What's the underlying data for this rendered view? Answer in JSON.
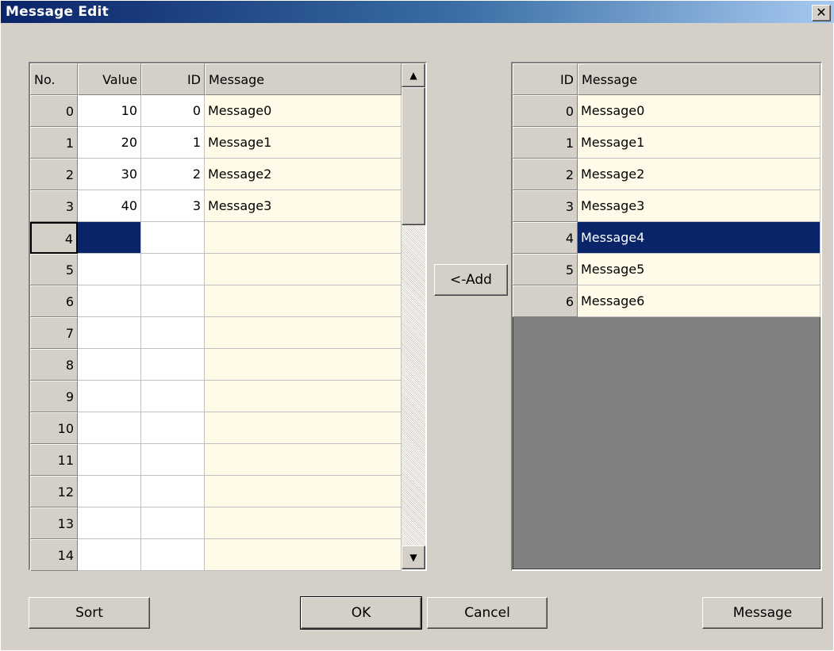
{
  "window": {
    "title": "Message Edit",
    "close_glyph": "✕"
  },
  "left_grid": {
    "headers": [
      "No.",
      "Value",
      "ID",
      "Message"
    ],
    "rows": [
      {
        "no": "0",
        "value": "10",
        "id": "0",
        "message": "Message0"
      },
      {
        "no": "1",
        "value": "20",
        "id": "1",
        "message": "Message1"
      },
      {
        "no": "2",
        "value": "30",
        "id": "2",
        "message": "Message2"
      },
      {
        "no": "3",
        "value": "40",
        "id": "3",
        "message": "Message3"
      },
      {
        "no": "4",
        "value": "",
        "id": "",
        "message": ""
      },
      {
        "no": "5",
        "value": "",
        "id": "",
        "message": ""
      },
      {
        "no": "6",
        "value": "",
        "id": "",
        "message": ""
      },
      {
        "no": "7",
        "value": "",
        "id": "",
        "message": ""
      },
      {
        "no": "8",
        "value": "",
        "id": "",
        "message": ""
      },
      {
        "no": "9",
        "value": "",
        "id": "",
        "message": ""
      },
      {
        "no": "10",
        "value": "",
        "id": "",
        "message": ""
      },
      {
        "no": "11",
        "value": "",
        "id": "",
        "message": ""
      },
      {
        "no": "12",
        "value": "",
        "id": "",
        "message": ""
      },
      {
        "no": "13",
        "value": "",
        "id": "",
        "message": ""
      },
      {
        "no": "14",
        "value": "",
        "id": "",
        "message": ""
      }
    ],
    "selected_row": 4,
    "scroll_up_glyph": "▲",
    "scroll_down_glyph": "▼"
  },
  "right_grid": {
    "headers": [
      "ID",
      "Message"
    ],
    "rows": [
      {
        "id": "0",
        "message": "Message0"
      },
      {
        "id": "1",
        "message": "Message1"
      },
      {
        "id": "2",
        "message": "Message2"
      },
      {
        "id": "3",
        "message": "Message3"
      },
      {
        "id": "4",
        "message": "Message4"
      },
      {
        "id": "5",
        "message": "Message5"
      },
      {
        "id": "6",
        "message": "Message6"
      }
    ],
    "selected_row": 4
  },
  "buttons": {
    "add": "<-Add",
    "sort": "Sort",
    "ok": "OK",
    "cancel": "Cancel",
    "message": "Message"
  },
  "colors": {
    "title_start": "#0a246a",
    "title_end": "#a6caf0",
    "message_cell_bg": "#fffbe8",
    "selection": "#0a246a",
    "dialog_bg": "#d4d0c8"
  }
}
